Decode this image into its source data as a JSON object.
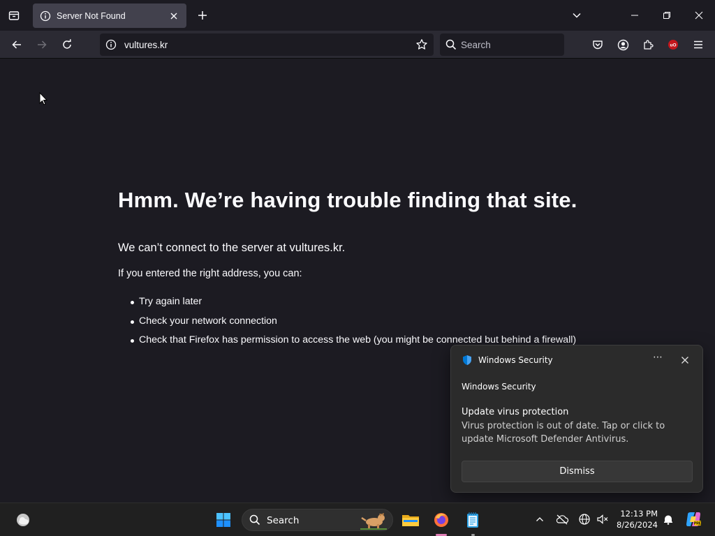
{
  "browser": {
    "tab": {
      "title": "Server Not Found"
    },
    "url": "vultures.kr",
    "search_placeholder": "Search"
  },
  "error_page": {
    "title": "Hmm. We’re having trouble finding that site.",
    "subtitle": "We can’t connect to the server at vultures.kr.",
    "lead": "If you entered the right address, you can:",
    "suggestions": [
      "Try again later",
      "Check your network connection",
      "Check that Firefox has permission to access the web (you might be connected but behind a firewall)"
    ]
  },
  "notification": {
    "app_name": "Windows Security",
    "source": "Windows Security",
    "title": "Update virus protection",
    "body": "Virus protection is out of date. Tap or click to update Microsoft Defender Antivirus.",
    "more": "⋯",
    "dismiss_label": "Dismiss"
  },
  "taskbar": {
    "search_label": "Search",
    "time": "12:13 PM",
    "date": "8/26/2024"
  },
  "colors": {
    "page_bg": "#1c1b22",
    "toolbar_bg": "#2b2a33",
    "tab_active": "#42414d",
    "taskbar_bg": "#202020",
    "ublock_red": "#c4161c",
    "windows_blue": "#0078d4"
  }
}
